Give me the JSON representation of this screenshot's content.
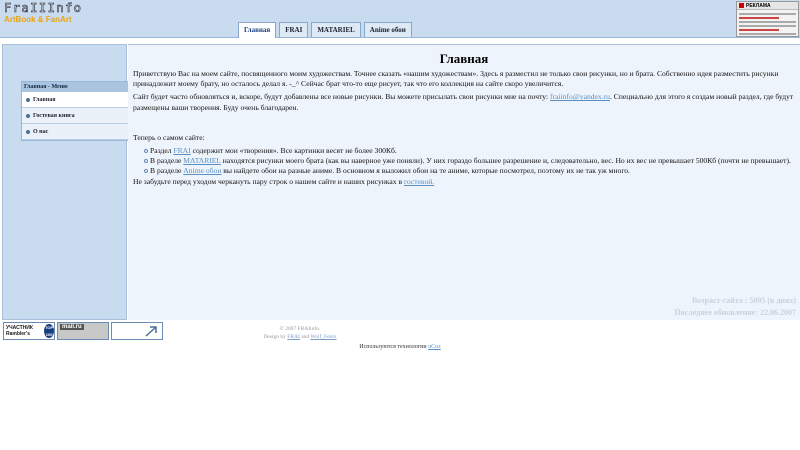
{
  "header": {
    "logo_text": "FraIIInfo",
    "tagline": "ArtBook & FanArt",
    "tabs": [
      {
        "label": "Главная",
        "active": true
      },
      {
        "label": "FRAI",
        "active": false
      },
      {
        "label": "MATARIEL",
        "active": false
      },
      {
        "label": "Anime обои",
        "active": false
      }
    ],
    "ad_label": "РЕКЛАМА"
  },
  "sidebar": {
    "menu_title": "Главная - Меню",
    "items": [
      {
        "label": "Главная",
        "active": true
      },
      {
        "label": "Гостевая книга",
        "active": false
      },
      {
        "label": "О нас",
        "active": false
      }
    ]
  },
  "main": {
    "title": "Главная",
    "p1": "Приветствую Вас на моем сайте, посвященного моим художествам. Точнее сказать «нашим художествам». Здесь я разместил не только свои рисунки, но и брата. Собственно идея разместить рисунки принадлежит моему брату, но осталось делал я. -_^ Сейчас брат что-то еще рисует, так что его коллекция на сайте скоро увеличится.",
    "p2_a": "Сайт будет часто обновляться и, вскоре, будут добавлены все новые рисунки. Вы можете присылать свои рисунки мне на почту:",
    "p2_link": "fraiinfo@yandex.ru",
    "p2_b": ". Специально для этого я создам новый раздел, где будут размещены ваши творения. Буду очень благодарен.",
    "about_heading": "Теперь о самом сайте:",
    "list": [
      {
        "pre": "Раздел",
        "link": "FRAI",
        "post": "содержит мои «творения». Все картинки весят не более 300Кб."
      },
      {
        "pre": "В разделе",
        "link": "MATARIEL",
        "post": "находятся рисунки моего брата (как вы наверное уже поняли). У них гораздо большее разрешение и, следовательно, вес. Но их вес не превышает 500Кб (почти не превышает)."
      },
      {
        "pre": "В разделе",
        "link": "Anime обои",
        "post": "вы найдете обои на разные аниме. В основном я выложил обои на те аниме, которые посмотрел, поэтому их не так уж много."
      }
    ],
    "closing_a": "Не забудьте перед уходом черкануть пару строк о нашем сайте и наших рисунках в",
    "closing_link": "гостевой.",
    "stat_age": "Возраст сайта : 5095 (в днях)",
    "stat_update": "Последнее обновление: 22.06.2007"
  },
  "footer": {
    "badge_rambler": "УЧАСТНИК Rambler's",
    "badge_rambler_top": "TOP 100",
    "badge_mail": "mail.ru",
    "copyright": "© 2007 FRAIinfo.",
    "design_by": "Design by",
    "design_link1": "FRAI",
    "design_and": "and",
    "design_link2": "Wolf_Fenix",
    "tech_text": "Используются технологии",
    "tech_link": "uCoz"
  }
}
